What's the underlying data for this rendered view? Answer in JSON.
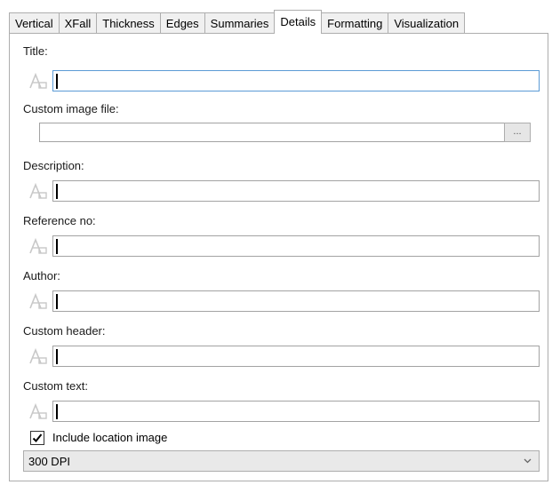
{
  "tabs": [
    {
      "label": "Vertical",
      "active": false
    },
    {
      "label": "XFall",
      "active": false
    },
    {
      "label": "Thickness",
      "active": false
    },
    {
      "label": "Edges",
      "active": false
    },
    {
      "label": "Summaries",
      "active": false
    },
    {
      "label": "Details",
      "active": true
    },
    {
      "label": "Formatting",
      "active": false
    },
    {
      "label": "Visualization",
      "active": false
    }
  ],
  "form": {
    "title_label": "Title:",
    "title_value": "",
    "custom_image_label": "Custom image file:",
    "custom_image_value": "",
    "browse_label": "...",
    "description_label": "Description:",
    "description_value": "",
    "reference_label": "Reference no:",
    "reference_value": "",
    "author_label": "Author:",
    "author_value": "",
    "custom_header_label": "Custom header:",
    "custom_header_value": "",
    "custom_text_label": "Custom text:",
    "custom_text_value": "",
    "include_location_label": "Include location image",
    "include_location_checked": true,
    "dpi_value": "300 DPI"
  },
  "icons": {
    "field_tool": "text-tool-icon",
    "browse": "ellipsis",
    "dropdown": "chevron-down-icon"
  },
  "colors": {
    "focus_border": "#5b9bd5",
    "field_border": "#a3a3a3",
    "tab_bg": "#f0f0f0"
  }
}
